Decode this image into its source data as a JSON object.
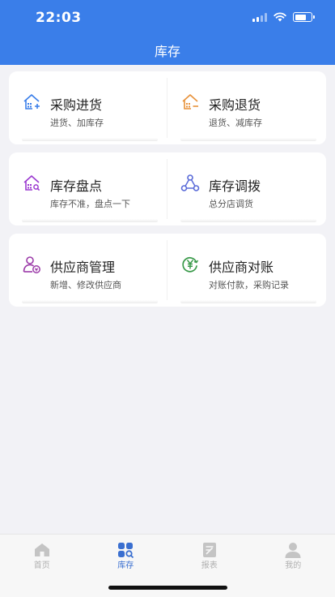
{
  "status_bar": {
    "time": "22:03",
    "battery_level": 0.7
  },
  "header": {
    "title": "库存"
  },
  "cards": [
    {
      "items": [
        {
          "name": "purchase-in",
          "title": "采购进货",
          "subtitle": "进货、加库存",
          "icon": "house-plus-icon",
          "color": "#3a7ee9"
        },
        {
          "name": "purchase-return",
          "title": "采购退货",
          "subtitle": "退货、减库存",
          "icon": "house-minus-icon",
          "color": "#e8923a"
        }
      ]
    },
    {
      "items": [
        {
          "name": "stocktake",
          "title": "库存盘点",
          "subtitle": "库存不准，盘点一下",
          "icon": "house-search-icon",
          "color": "#9b3ad0"
        },
        {
          "name": "stock-transfer",
          "title": "库存调拨",
          "subtitle": "总分店调货",
          "icon": "transfer-icon",
          "color": "#5a6bd8"
        }
      ]
    },
    {
      "items": [
        {
          "name": "supplier-manage",
          "title": "供应商管理",
          "subtitle": "新增、修改供应商",
          "icon": "supplier-icon",
          "color": "#9b3aa8"
        },
        {
          "name": "supplier-reconcile",
          "title": "供应商对账",
          "subtitle": "对账付款，采购记录",
          "icon": "yen-coin-icon",
          "color": "#3a9a4a"
        }
      ]
    }
  ],
  "tabbar": {
    "tabs": [
      {
        "label": "首页",
        "icon": "home-icon",
        "active": false
      },
      {
        "label": "库存",
        "icon": "inventory-icon",
        "active": true
      },
      {
        "label": "报表",
        "icon": "report-icon",
        "active": false
      },
      {
        "label": "我的",
        "icon": "user-icon",
        "active": false
      }
    ]
  }
}
